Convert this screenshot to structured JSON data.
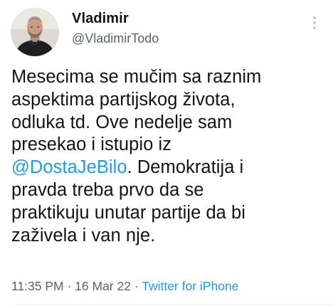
{
  "author": {
    "display_name": "Vladimir",
    "handle": "@VladimirTodo",
    "avatar_icon": "profile-photo"
  },
  "more_icon": "more-vertical-icon",
  "tweet": {
    "text_part1": "Mesecima se mučim sa raznim\naspektima partijskog života,\nodluka td. Ove nedelje sam\npresekao i istupio iz\n",
    "mention": "@DostaJeBilo",
    "text_part2": ". Demokratija i\npravda treba prvo da se\npraktikuju unutar partije da bi\nzaživela i van nje."
  },
  "meta": {
    "time": "11:35 PM",
    "separator1": " · ",
    "date": "16 Mar 22",
    "separator2": " · ",
    "source": "Twitter for iPhone"
  },
  "colors": {
    "link": "#1d9bf0",
    "secondary": "#536471",
    "text": "#0f1419"
  }
}
